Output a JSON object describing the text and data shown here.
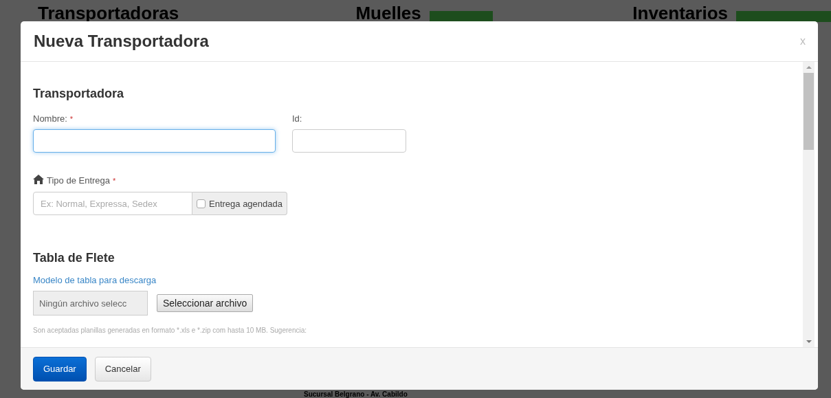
{
  "background": {
    "headings": [
      {
        "text": "Transportadoras",
        "has_tag": false
      },
      {
        "text": "Muelles",
        "has_tag": true
      },
      {
        "text": "Inventarios",
        "has_tag": true
      }
    ],
    "footer_text": "Sucursal Belgrano - Av. Cabildo"
  },
  "modal": {
    "title": "Nueva Transportadora",
    "close": "x",
    "sections": [
      {
        "kind": "fields",
        "heading": "Transportadora",
        "fields": [
          {
            "label": "Nombre:",
            "required_mark": "*",
            "focused": true
          },
          {
            "label": "Id:",
            "focused": false
          }
        ],
        "delivery": {
          "label": "Tipo de Entrega",
          "required_mark": "*",
          "placeholder": "Ex: Normal, Expressa, Sedex",
          "checkbox": {
            "label": "Entrega agendada",
            "checked": false
          }
        }
      },
      {
        "kind": "upload",
        "heading": "Tabla de Flete",
        "link": "Modelo de tabla para descarga",
        "file_name": "Ningún archivo selecc",
        "file_button": "Seleccionar archivo",
        "hint": "Son aceptadas planillas generadas en formato *.xls e *.zip com hasta 10 MB. Sugerencia:"
      }
    ],
    "buttons": [
      {
        "label": "Guardar",
        "kind": "primary"
      },
      {
        "label": "Cancelar",
        "kind": "default"
      }
    ]
  }
}
